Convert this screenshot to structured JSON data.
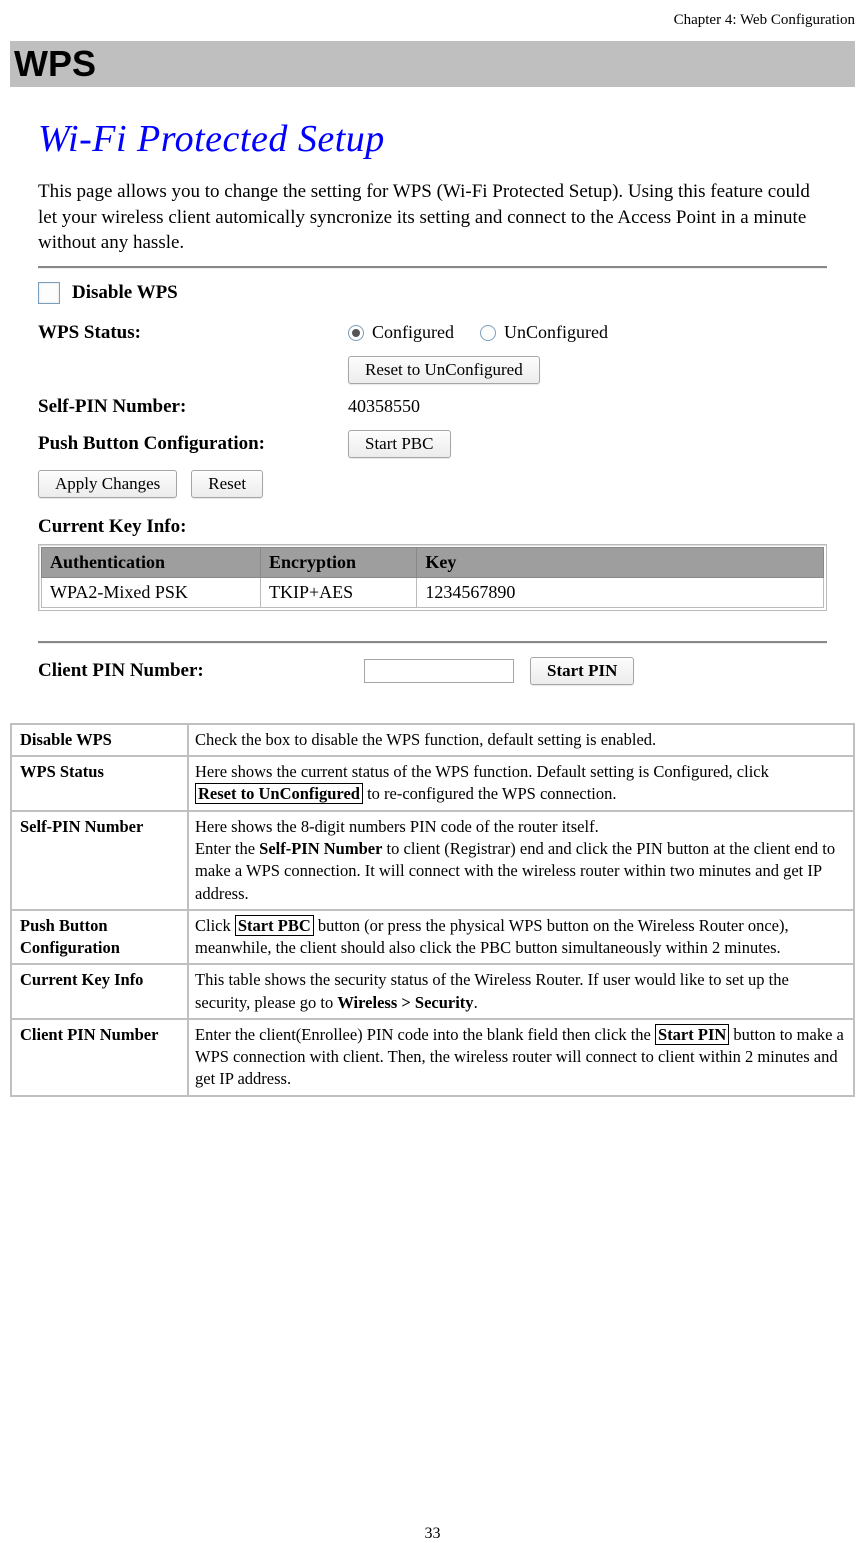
{
  "chapter_header": "Chapter 4: Web Configuration",
  "section_title": "WPS",
  "page_number": "33",
  "screenshot": {
    "title": "Wi-Fi Protected Setup",
    "intro": "This page allows you to change the setting for WPS (Wi-Fi Protected Setup). Using this feature could let your wireless client automically syncronize its setting and connect to the Access Point in a minute without any hassle.",
    "disable_label": "Disable WPS",
    "status_label": "WPS Status:",
    "status_opt_configured": "Configured",
    "status_opt_unconfigured": "UnConfigured",
    "reset_btn": "Reset to UnConfigured",
    "selfpin_label": "Self-PIN Number:",
    "selfpin_value": "40358550",
    "pbc_label": "Push Button Configuration:",
    "pbc_btn": "Start PBC",
    "apply_btn": "Apply Changes",
    "reset2_btn": "Reset",
    "keyinfo_heading": "Current Key Info:",
    "keyinfo_headers": {
      "auth": "Authentication",
      "enc": "Encryption",
      "key": "Key"
    },
    "keyinfo_row": {
      "auth": "WPA2-Mixed PSK",
      "enc": "TKIP+AES",
      "key": "1234567890"
    },
    "clientpin_label": "Client PIN Number:",
    "startpin_btn": "Start PIN"
  },
  "desc": {
    "r1_term": "Disable WPS",
    "r1_text": "Check the box to disable the WPS function, default setting is enabled.",
    "r2_term": "WPS Status",
    "r2_pre": "Here shows the current status of the WPS function. Default setting is Configured, click ",
    "r2_btn": "Reset to UnConfigured",
    "r2_post": " to re-configured the WPS connection.",
    "r3_term": "Self-PIN Number",
    "r3_line1": "Here shows the 8-digit numbers PIN code of the router itself.",
    "r3_line2a": "Enter the ",
    "r3_line2_bold": "Self-PIN Number",
    "r3_line2b": " to client (Registrar) end and click the PIN button at the client end to make a WPS connection. It will connect with the wireless router within two minutes and get IP address.",
    "r4_term": "Push Button Configuration",
    "r4_pre": "Click ",
    "r4_btn": "Start PBC",
    "r4_post": " button (or press the physical WPS button on the Wireless Router once), meanwhile, the client should also click the PBC button simultaneously within 2 minutes.",
    "r5_term": "Current Key Info",
    "r5_pre": "This table shows the security status of the Wireless Router. If user would like to set up the security, please go to ",
    "r5_bold": "Wireless > Security",
    "r5_post": ".",
    "r6_term": "Client PIN Number",
    "r6_pre": "Enter the client(Enrollee) PIN code into the blank field then click the ",
    "r6_btn": "Start PIN",
    "r6_post": " button to make a WPS connection with client. Then, the wireless router will connect to client within 2 minutes and get IP address."
  }
}
